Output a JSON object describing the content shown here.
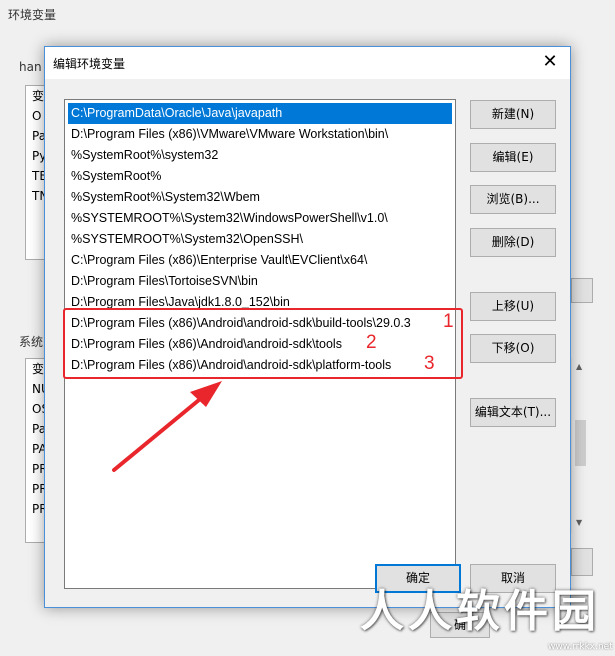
{
  "background_window": {
    "title": "环境变量",
    "user_group_label": "han",
    "user_vars_partial": [
      "变",
      "O",
      "Pa",
      "Py",
      "TE",
      "TN"
    ],
    "system_group_label": "系统",
    "system_vars_partial": [
      "变",
      "NU",
      "OS",
      "Pa",
      "PA",
      "PR",
      "PR",
      "PR"
    ],
    "partial_button_label": "确"
  },
  "dialog": {
    "title": "编辑环境变量",
    "paths": [
      "C:\\ProgramData\\Oracle\\Java\\javapath",
      "D:\\Program Files (x86)\\VMware\\VMware Workstation\\bin\\",
      "%SystemRoot%\\system32",
      "%SystemRoot%",
      "%SystemRoot%\\System32\\Wbem",
      "%SYSTEMROOT%\\System32\\WindowsPowerShell\\v1.0\\",
      "%SYSTEMROOT%\\System32\\OpenSSH\\",
      "C:\\Program Files (x86)\\Enterprise Vault\\EVClient\\x64\\",
      "D:\\Program Files\\TortoiseSVN\\bin",
      "D:\\Program Files\\Java\\jdk1.8.0_152\\bin",
      "D:\\Program Files (x86)\\Android\\android-sdk\\build-tools\\29.0.3",
      "D:\\Program Files (x86)\\Android\\android-sdk\\tools",
      "D:\\Program Files (x86)\\Android\\android-sdk\\platform-tools"
    ],
    "selected_index": 0,
    "buttons": {
      "new": "新建(N)",
      "edit": "编辑(E)",
      "browse": "浏览(B)...",
      "delete": "删除(D)",
      "move_up": "上移(U)",
      "move_down": "下移(O)",
      "edit_text": "编辑文本(T)...",
      "ok": "确定",
      "cancel": "取消"
    }
  },
  "annotations": {
    "numbers": [
      "1",
      "2",
      "3"
    ],
    "color": "#e8262b"
  },
  "watermark": {
    "text": "人人软件园",
    "sub": "www.rrkkx.net"
  },
  "colors": {
    "selection": "#0078d7",
    "dialog_border": "#4a90d9",
    "annotation": "#e8262b"
  }
}
